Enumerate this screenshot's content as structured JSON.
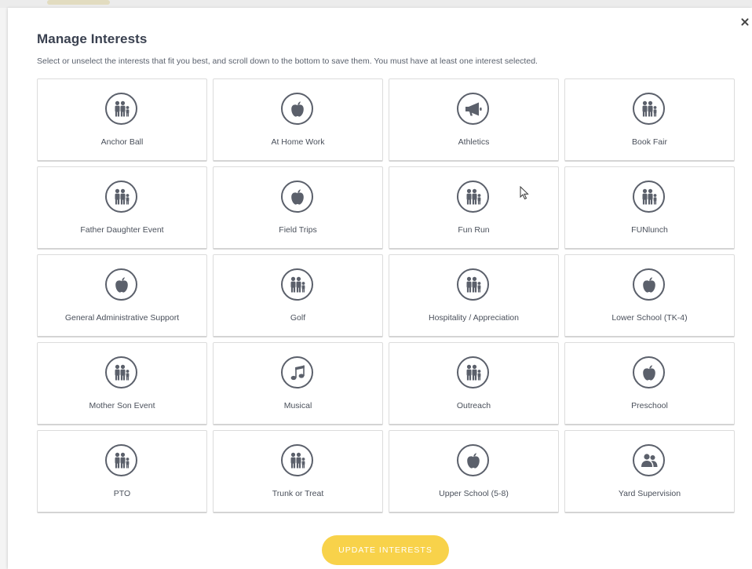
{
  "modal": {
    "title": "Manage Interests",
    "subtitle": "Select or unselect the interests that fit you best, and scroll down to the bottom to save them. You must have at least one interest selected.",
    "close_label": "×"
  },
  "interests": [
    {
      "label": "Anchor Ball",
      "icon": "family-icon"
    },
    {
      "label": "At Home Work",
      "icon": "apple-icon"
    },
    {
      "label": "Athletics",
      "icon": "megaphone-icon"
    },
    {
      "label": "Book Fair",
      "icon": "family-icon"
    },
    {
      "label": "Father Daughter Event",
      "icon": "family-icon"
    },
    {
      "label": "Field Trips",
      "icon": "apple-icon"
    },
    {
      "label": "Fun Run",
      "icon": "family-icon"
    },
    {
      "label": "FUNlunch",
      "icon": "family-icon"
    },
    {
      "label": "General Administrative Support",
      "icon": "apple-icon"
    },
    {
      "label": "Golf",
      "icon": "family-icon"
    },
    {
      "label": "Hospitality / Appreciation",
      "icon": "family-icon"
    },
    {
      "label": "Lower School (TK-4)",
      "icon": "apple-icon"
    },
    {
      "label": "Mother Son Event",
      "icon": "family-icon"
    },
    {
      "label": "Musical",
      "icon": "music-note-icon"
    },
    {
      "label": "Outreach",
      "icon": "family-icon"
    },
    {
      "label": "Preschool",
      "icon": "apple-icon"
    },
    {
      "label": "PTO",
      "icon": "family-icon"
    },
    {
      "label": "Trunk or Treat",
      "icon": "family-icon"
    },
    {
      "label": "Upper School (5-8)",
      "icon": "apple-icon"
    },
    {
      "label": "Yard Supervision",
      "icon": "users-icon"
    }
  ],
  "footer": {
    "update_label": "UPDATE INTERESTS"
  },
  "colors": {
    "accent": "#f8d24a",
    "icon": "#5b606b",
    "border": "#dcdcdc"
  }
}
